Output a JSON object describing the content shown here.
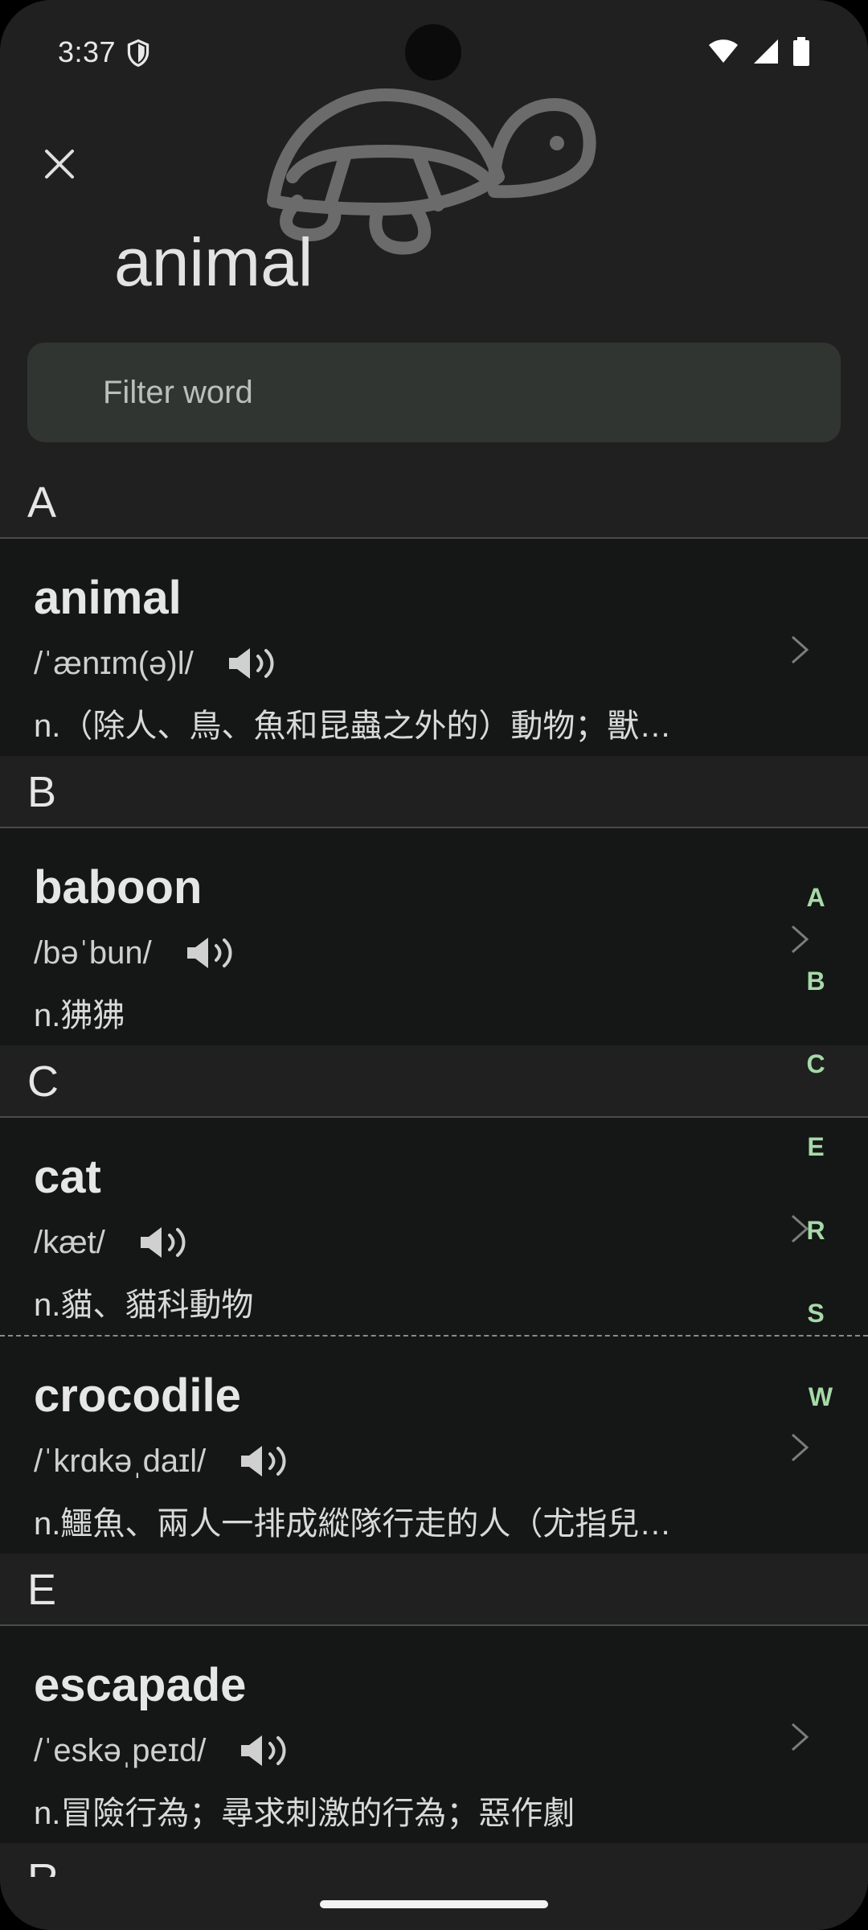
{
  "status": {
    "time": "3:37"
  },
  "header": {
    "title": "animal",
    "close_icon": "close-icon",
    "illustration": "turtle-illustration"
  },
  "filter": {
    "placeholder": "Filter word"
  },
  "sections": [
    {
      "letter": "A",
      "entries": [
        {
          "word": "animal",
          "phonetic": "/ˈænɪm(ə)l/",
          "definition": "n.（除人、鳥、魚和昆蟲之外的）動物；獸…"
        }
      ]
    },
    {
      "letter": "B",
      "entries": [
        {
          "word": "baboon",
          "phonetic": "/bəˈbun/",
          "definition": "n.狒狒"
        }
      ]
    },
    {
      "letter": "C",
      "entries": [
        {
          "word": "cat",
          "phonetic": "/kæt/",
          "definition": "n.貓、貓科動物"
        },
        {
          "word": "crocodile",
          "phonetic": "/ˈkrɑkəˌdaɪl/",
          "definition": "n.鱷魚、兩人一排成縱隊行走的人（尤指兒…"
        }
      ]
    },
    {
      "letter": "E",
      "entries": [
        {
          "word": "escapade",
          "phonetic": "/ˈeskəˌpeɪd/",
          "definition": "n.冒險行為；尋求刺激的行為；惡作劇"
        }
      ]
    },
    {
      "letter": "R",
      "entries": []
    }
  ],
  "index_letters": [
    "A",
    "B",
    "C",
    "E",
    "R",
    "S",
    "W"
  ],
  "colors": {
    "background": "#202020",
    "entry_bg": "#141716",
    "accent": "#a6d9a8",
    "filter_bg": "#313531"
  }
}
